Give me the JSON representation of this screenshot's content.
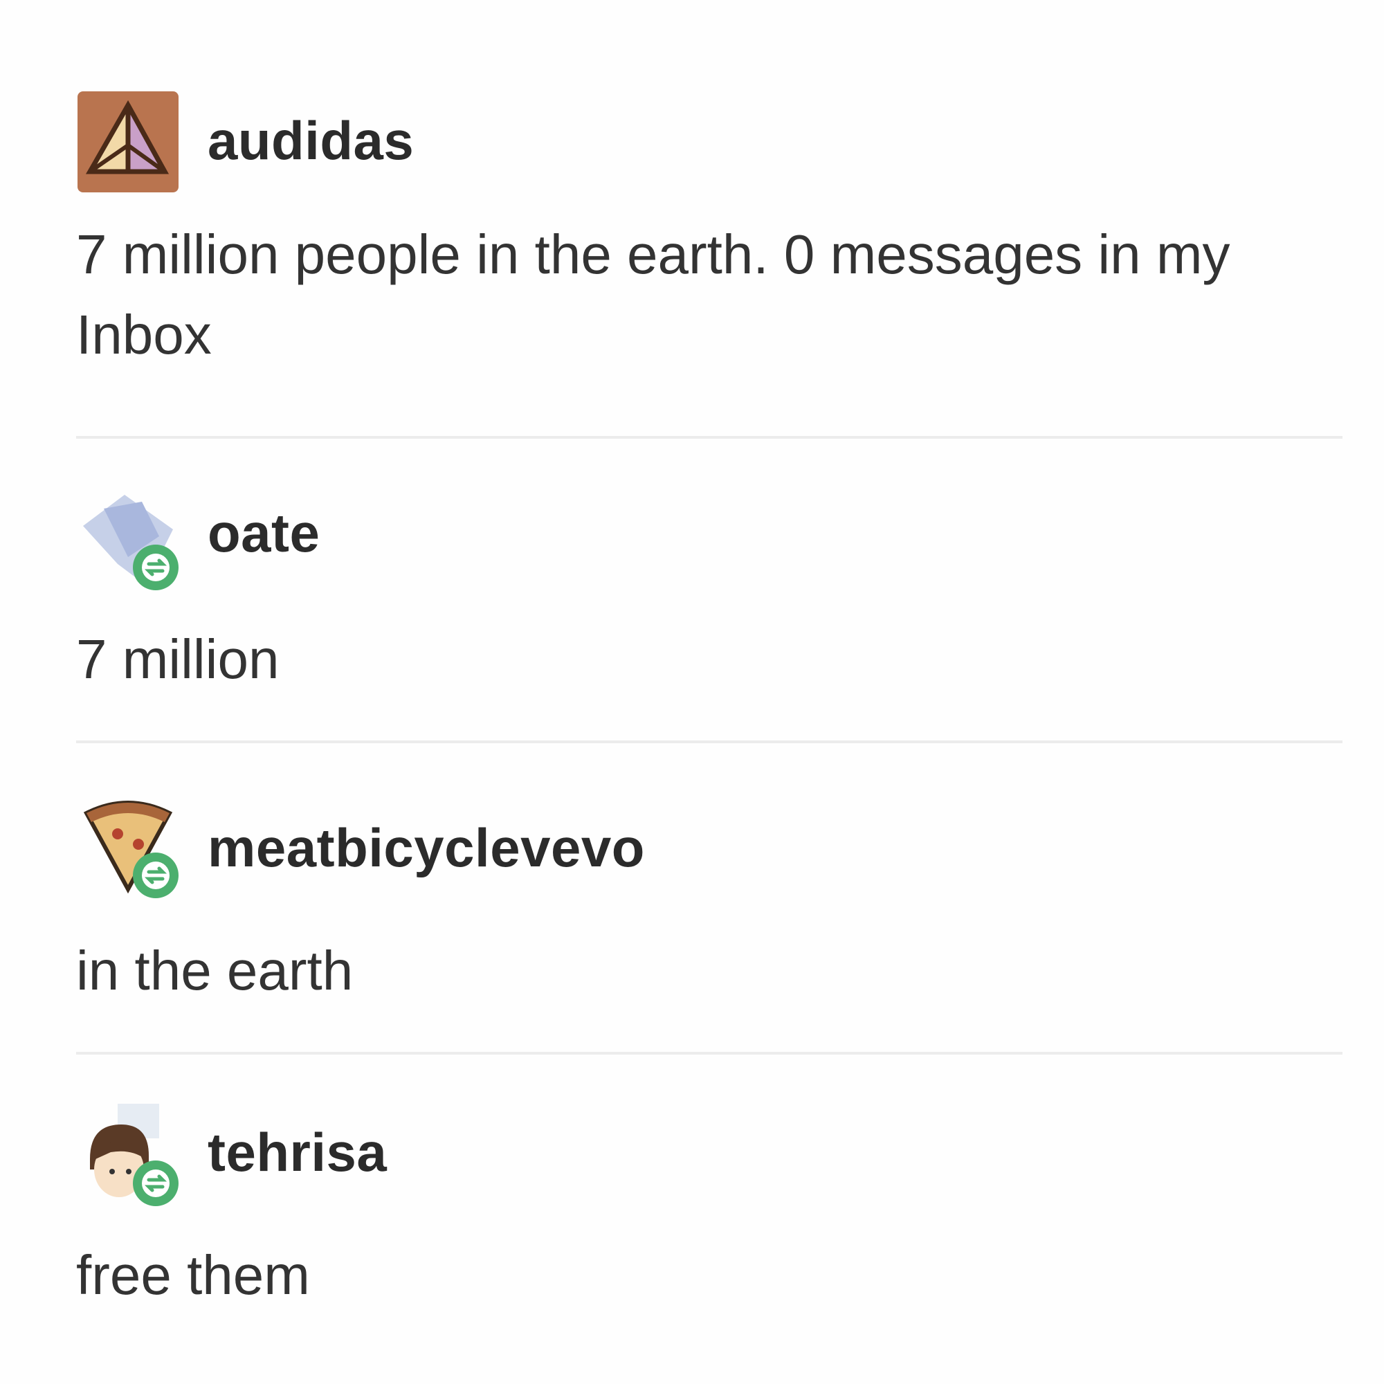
{
  "posts": [
    {
      "username": "audidas",
      "text": "7 million people in the earth. 0 messages in my Inbox",
      "avatar_icon": "pyramid-avatar-icon",
      "reblogged": false
    },
    {
      "username": "oate",
      "text": "7 million",
      "avatar_icon": "blue-shape-avatar-icon",
      "reblogged": true
    },
    {
      "username": "meatbicyclevevo",
      "text": "in the earth",
      "avatar_icon": "pizza-slice-avatar-icon",
      "reblogged": true
    },
    {
      "username": "tehrisa",
      "text": "free them",
      "avatar_icon": "character-face-avatar-icon",
      "reblogged": true
    }
  ],
  "colors": {
    "reblog_badge": "#4caf6e",
    "username": "#2b2b2b",
    "text": "#333333",
    "divider": "#ececec"
  }
}
